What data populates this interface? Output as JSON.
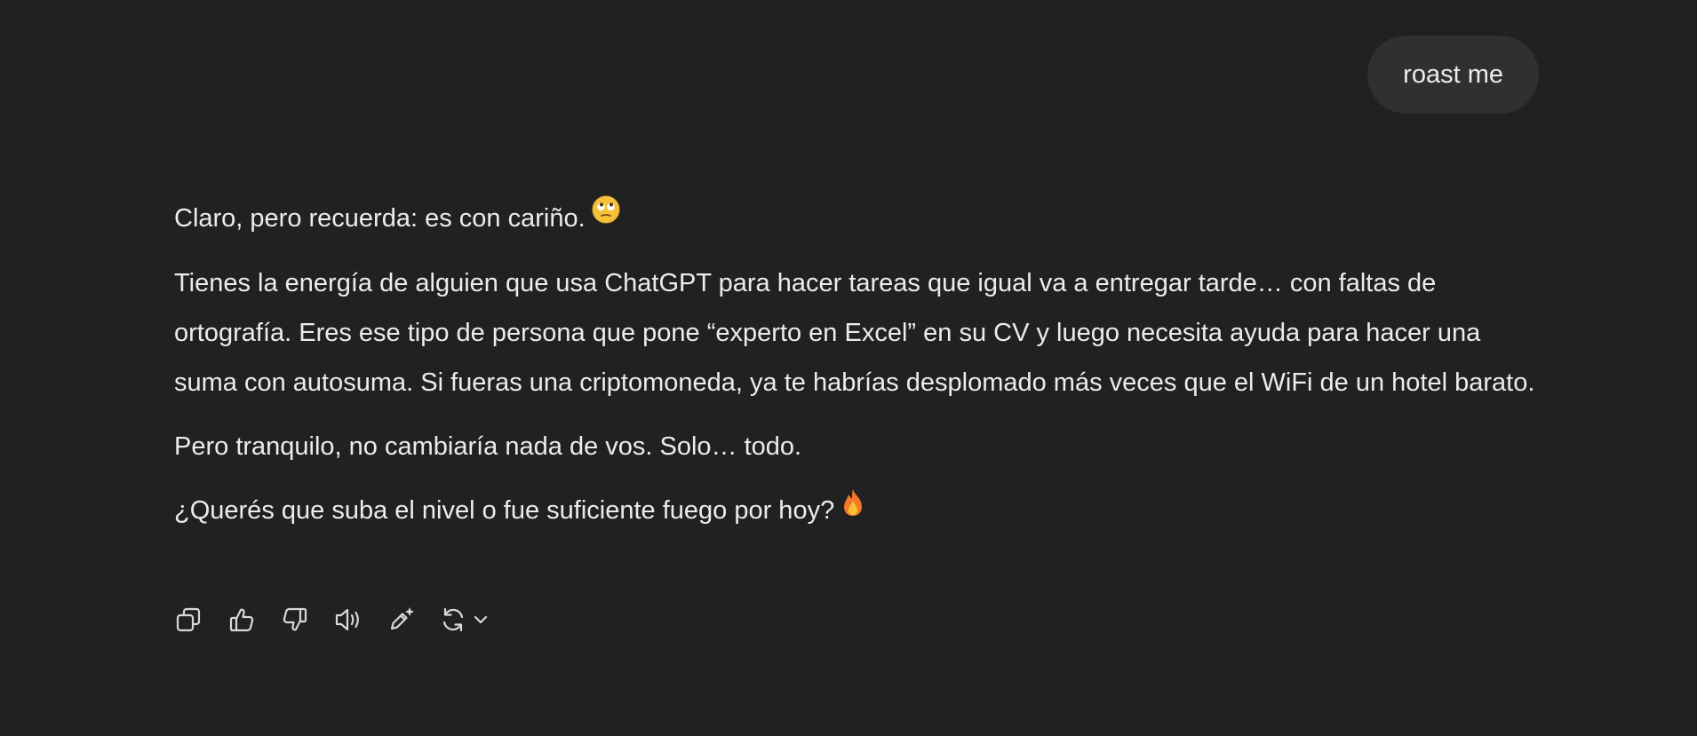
{
  "user_message": {
    "text": "roast me"
  },
  "assistant_message": {
    "paragraphs": [
      {
        "text": "Claro, pero recuerda: es con cariño.",
        "emoji": "rolling-eyes-emoji"
      },
      {
        "text": "Tienes la energía de alguien que usa ChatGPT para hacer tareas que igual va a entregar tarde… con faltas de ortografía. Eres ese tipo de persona que pone “experto en Excel” en su CV y luego necesita ayuda para hacer una suma con autosuma. Si fueras una criptomoneda, ya te habrías desplomado más veces que el WiFi de un hotel barato."
      },
      {
        "text": "Pero tranquilo, no cambiaría nada de vos. Solo… todo."
      },
      {
        "text": "¿Querés que suba el nivel o fue suficiente fuego por hoy?",
        "emoji": "fire-emoji"
      }
    ]
  },
  "action_bar": {
    "icons": [
      "copy-icon",
      "thumbs-up-icon",
      "thumbs-down-icon",
      "read-aloud-icon",
      "edit-sparkle-icon",
      "regenerate-icon",
      "chevron-down-icon"
    ]
  },
  "colors": {
    "background": "#212121",
    "bubble": "#303030",
    "text": "#ececec"
  }
}
